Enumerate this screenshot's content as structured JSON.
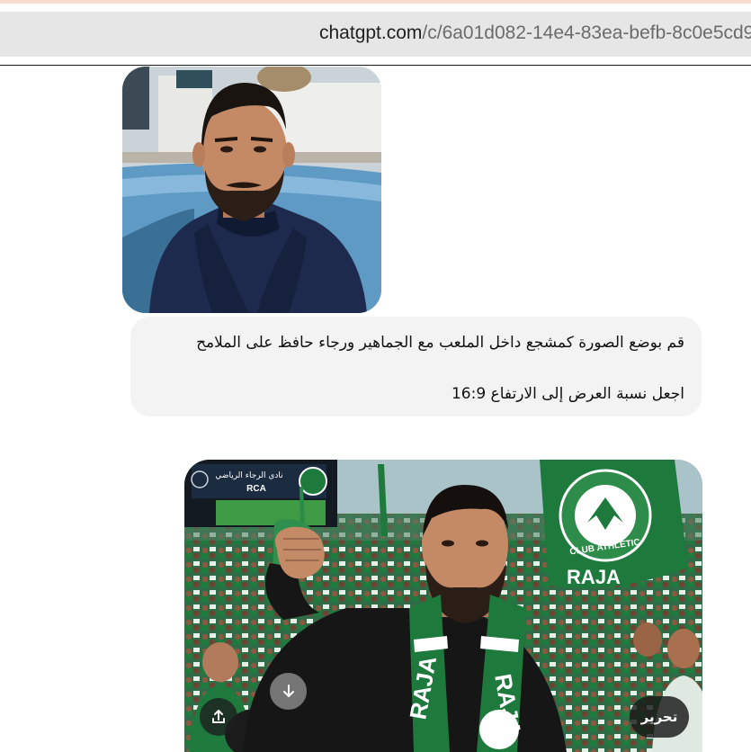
{
  "browser": {
    "url_host": "chatgpt.com",
    "url_path": "/c/6a01d082-14e4-83ea-befb-8c0e5cd9"
  },
  "conversation": {
    "user_message": {
      "line1": "قم بوضع الصورة كمشجع داخل الملعب مع الجماهير ورجاء حافظ على الملامح",
      "line2": "اجعل نسبة العرض إلى الارتفاع 16:9"
    },
    "generated_image": {
      "scoreboard_title": "نادي الرجاء الرياضي",
      "scoreboard_abbr": "RCA",
      "flag_text": "CLUB ATHLETIC",
      "flag_name": "RAJA",
      "scarf_text": "RAJA",
      "actions": {
        "edit_label": "تحرير",
        "download_icon": "download-arrow-icon",
        "share_icon": "share-upload-icon"
      }
    }
  },
  "colors": {
    "raja_green": "#1e7a3c",
    "bubble_bg": "#f3f3f3",
    "address_bar_bg": "#e6e6e6"
  }
}
